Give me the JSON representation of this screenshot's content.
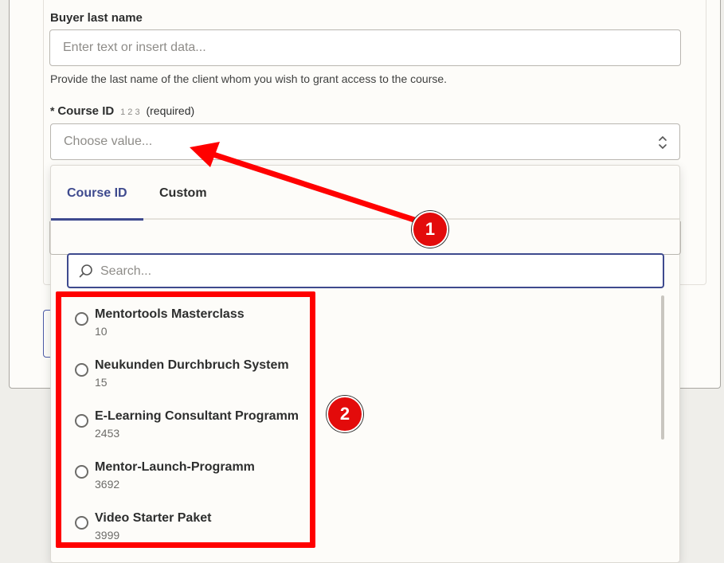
{
  "form": {
    "buyer_last_name": {
      "label": "Buyer last name",
      "placeholder": "Enter text or insert data...",
      "help": "Provide the last name of the client whom you wish to grant access to the course."
    },
    "course_id": {
      "star": "*",
      "label": "Course ID",
      "type_hint": "1 2 3",
      "required": "(required)",
      "placeholder": "Choose value..."
    }
  },
  "dropdown": {
    "tabs": [
      {
        "label": "Course ID",
        "active": true
      },
      {
        "label": "Custom",
        "active": false
      }
    ],
    "search_placeholder": "Search...",
    "options": [
      {
        "title": "Mentortools Masterclass",
        "id": "10"
      },
      {
        "title": "Neukunden Durchbruch System",
        "id": "15"
      },
      {
        "title": "E-Learning Consultant Programm",
        "id": "2453"
      },
      {
        "title": "Mentor-Launch-Programm",
        "id": "3692"
      },
      {
        "title": "Video Starter Paket",
        "id": "3999"
      }
    ]
  },
  "annotations": {
    "badge_1": "1",
    "badge_2": "2",
    "color": "#e30b0b"
  },
  "colors": {
    "accent": "#3e4a8e",
    "highlight": "#ff0000"
  }
}
